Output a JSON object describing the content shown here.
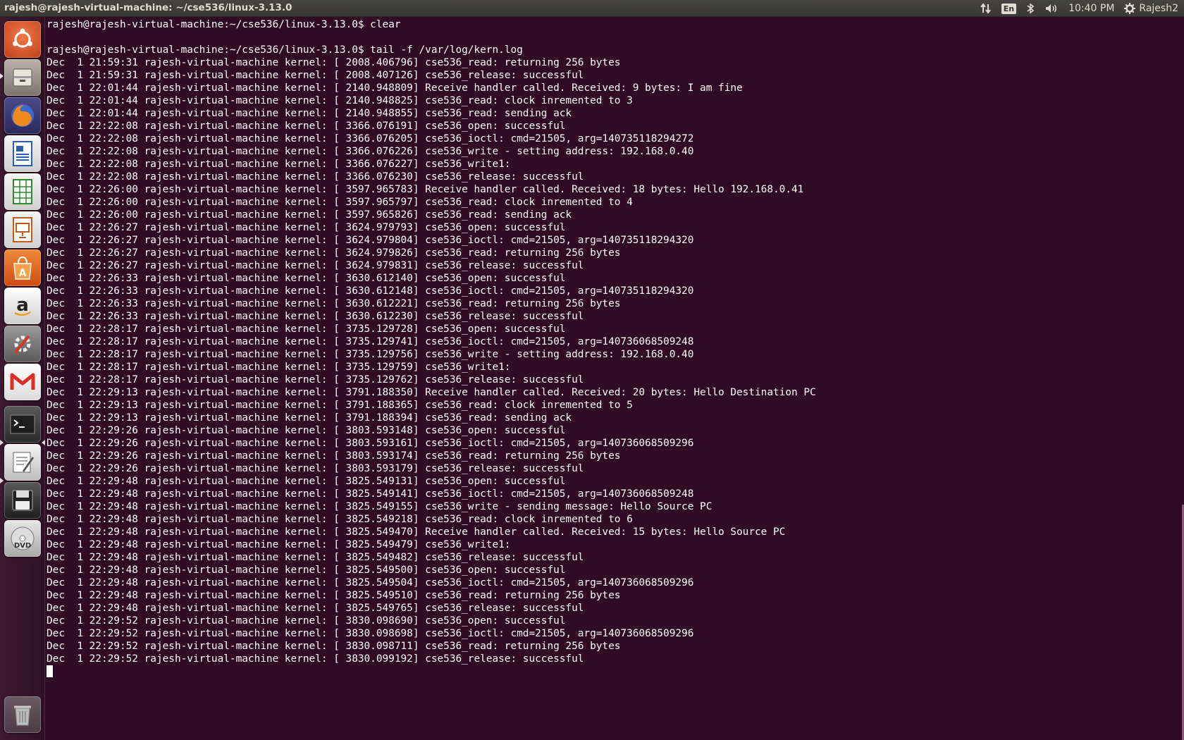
{
  "topbar": {
    "window_title": "rajesh@rajesh-virtual-machine: ~/cse536/linux-3.13.0",
    "keyboard_layout": "En",
    "time": "10:40 PM",
    "user": "Rajesh2"
  },
  "launcher": {
    "items": [
      {
        "name": "dash-home",
        "icon": "ubuntu-logo-icon",
        "color": "#e05a2a"
      },
      {
        "name": "files",
        "icon": "file-cabinet-icon",
        "color": "#8e8a80"
      },
      {
        "name": "firefox",
        "icon": "firefox-icon",
        "color": "#e66000"
      },
      {
        "name": "libreoffice-writer",
        "icon": "document-icon",
        "color": "#2a5fb0"
      },
      {
        "name": "libreoffice-calc",
        "icon": "spreadsheet-icon",
        "color": "#2f8a2f"
      },
      {
        "name": "libreoffice-impress",
        "icon": "presentation-icon",
        "color": "#c45a1a"
      },
      {
        "name": "ubuntu-software-center",
        "icon": "shopping-bag-icon",
        "color": "#e85a1a"
      },
      {
        "name": "amazon",
        "icon": "amazon-icon",
        "color": "#d8d8d8"
      },
      {
        "name": "system-settings",
        "icon": "settings-tools-icon",
        "color": "#7a7a7a"
      },
      {
        "name": "gmail",
        "icon": "gmail-icon",
        "color": "#f2f2f2"
      },
      {
        "name": "terminal",
        "icon": "terminal-icon",
        "color": "#2b2b2b"
      },
      {
        "name": "text-editor",
        "icon": "text-editor-icon",
        "color": "#d9d9d9"
      },
      {
        "name": "floppy-disk",
        "icon": "floppy-disk-icon",
        "color": "#333333"
      },
      {
        "name": "dvd",
        "icon": "dvd-icon",
        "color": "#cccccc"
      },
      {
        "name": "trash",
        "icon": "trash-icon",
        "color": "#9a9a9a"
      }
    ]
  },
  "terminal": {
    "lines": [
      "rajesh@rajesh-virtual-machine:~/cse536/linux-3.13.0$ clear",
      "",
      "rajesh@rajesh-virtual-machine:~/cse536/linux-3.13.0$ tail -f /var/log/kern.log",
      "Dec  1 21:59:31 rajesh-virtual-machine kernel: [ 2008.406796] cse536_read: returning 256 bytes",
      "Dec  1 21:59:31 rajesh-virtual-machine kernel: [ 2008.407126] cse536_release: successful",
      "Dec  1 22:01:44 rajesh-virtual-machine kernel: [ 2140.948809] Receive handler called. Received: 9 bytes: I am fine",
      "Dec  1 22:01:44 rajesh-virtual-machine kernel: [ 2140.948825] cse536_read: clock inremented to 3",
      "Dec  1 22:01:44 rajesh-virtual-machine kernel: [ 2140.948855] cse536_read: sending ack",
      "Dec  1 22:22:08 rajesh-virtual-machine kernel: [ 3366.076191] cse536_open: successful",
      "Dec  1 22:22:08 rajesh-virtual-machine kernel: [ 3366.076205] cse536_ioctl: cmd=21505, arg=140735118294272",
      "Dec  1 22:22:08 rajesh-virtual-machine kernel: [ 3366.076226] cse536_write - setting address: 192.168.0.40",
      "Dec  1 22:22:08 rajesh-virtual-machine kernel: [ 3366.076227] cse536_write1:",
      "Dec  1 22:22:08 rajesh-virtual-machine kernel: [ 3366.076230] cse536_release: successful",
      "Dec  1 22:26:00 rajesh-virtual-machine kernel: [ 3597.965783] Receive handler called. Received: 18 bytes: Hello 192.168.0.41",
      "Dec  1 22:26:00 rajesh-virtual-machine kernel: [ 3597.965797] cse536_read: clock inremented to 4",
      "Dec  1 22:26:00 rajesh-virtual-machine kernel: [ 3597.965826] cse536_read: sending ack",
      "Dec  1 22:26:27 rajesh-virtual-machine kernel: [ 3624.979793] cse536_open: successful",
      "Dec  1 22:26:27 rajesh-virtual-machine kernel: [ 3624.979804] cse536_ioctl: cmd=21505, arg=140735118294320",
      "Dec  1 22:26:27 rajesh-virtual-machine kernel: [ 3624.979826] cse536_read: returning 256 bytes",
      "Dec  1 22:26:27 rajesh-virtual-machine kernel: [ 3624.979831] cse536_release: successful",
      "Dec  1 22:26:33 rajesh-virtual-machine kernel: [ 3630.612140] cse536_open: successful",
      "Dec  1 22:26:33 rajesh-virtual-machine kernel: [ 3630.612148] cse536_ioctl: cmd=21505, arg=140735118294320",
      "Dec  1 22:26:33 rajesh-virtual-machine kernel: [ 3630.612221] cse536_read: returning 256 bytes",
      "Dec  1 22:26:33 rajesh-virtual-machine kernel: [ 3630.612230] cse536_release: successful",
      "Dec  1 22:28:17 rajesh-virtual-machine kernel: [ 3735.129728] cse536_open: successful",
      "Dec  1 22:28:17 rajesh-virtual-machine kernel: [ 3735.129741] cse536_ioctl: cmd=21505, arg=140736068509248",
      "Dec  1 22:28:17 rajesh-virtual-machine kernel: [ 3735.129756] cse536_write - setting address: 192.168.0.40",
      "Dec  1 22:28:17 rajesh-virtual-machine kernel: [ 3735.129759] cse536_write1:",
      "Dec  1 22:28:17 rajesh-virtual-machine kernel: [ 3735.129762] cse536_release: successful",
      "Dec  1 22:29:13 rajesh-virtual-machine kernel: [ 3791.188350] Receive handler called. Received: 20 bytes: Hello Destination PC",
      "Dec  1 22:29:13 rajesh-virtual-machine kernel: [ 3791.188365] cse536_read: clock inremented to 5",
      "Dec  1 22:29:13 rajesh-virtual-machine kernel: [ 3791.188394] cse536_read: sending ack",
      "Dec  1 22:29:26 rajesh-virtual-machine kernel: [ 3803.593148] cse536_open: successful",
      "Dec  1 22:29:26 rajesh-virtual-machine kernel: [ 3803.593161] cse536_ioctl: cmd=21505, arg=140736068509296",
      "Dec  1 22:29:26 rajesh-virtual-machine kernel: [ 3803.593174] cse536_read: returning 256 bytes",
      "Dec  1 22:29:26 rajesh-virtual-machine kernel: [ 3803.593179] cse536_release: successful",
      "Dec  1 22:29:48 rajesh-virtual-machine kernel: [ 3825.549131] cse536_open: successful",
      "Dec  1 22:29:48 rajesh-virtual-machine kernel: [ 3825.549141] cse536_ioctl: cmd=21505, arg=140736068509248",
      "Dec  1 22:29:48 rajesh-virtual-machine kernel: [ 3825.549155] cse536_write - sending message: Hello Source PC",
      "Dec  1 22:29:48 rajesh-virtual-machine kernel: [ 3825.549218] cse536_read: clock inremented to 6",
      "Dec  1 22:29:48 rajesh-virtual-machine kernel: [ 3825.549470] Receive handler called. Received: 15 bytes: Hello Source PC",
      "Dec  1 22:29:48 rajesh-virtual-machine kernel: [ 3825.549479] cse536_write1:",
      "Dec  1 22:29:48 rajesh-virtual-machine kernel: [ 3825.549482] cse536_release: successful",
      "Dec  1 22:29:48 rajesh-virtual-machine kernel: [ 3825.549500] cse536_open: successful",
      "Dec  1 22:29:48 rajesh-virtual-machine kernel: [ 3825.549504] cse536_ioctl: cmd=21505, arg=140736068509296",
      "Dec  1 22:29:48 rajesh-virtual-machine kernel: [ 3825.549510] cse536_read: returning 256 bytes",
      "Dec  1 22:29:48 rajesh-virtual-machine kernel: [ 3825.549765] cse536_release: successful",
      "Dec  1 22:29:52 rajesh-virtual-machine kernel: [ 3830.098690] cse536_open: successful",
      "Dec  1 22:29:52 rajesh-virtual-machine kernel: [ 3830.098698] cse536_ioctl: cmd=21505, arg=140736068509296",
      "Dec  1 22:29:52 rajesh-virtual-machine kernel: [ 3830.098711] cse536_read: returning 256 bytes",
      "Dec  1 22:29:52 rajesh-virtual-machine kernel: [ 3830.099192] cse536_release: successful"
    ]
  },
  "colors": {
    "terminal_bg": "#300a24",
    "terminal_fg": "#ffffff",
    "panel_bg": "#3c3b37"
  }
}
